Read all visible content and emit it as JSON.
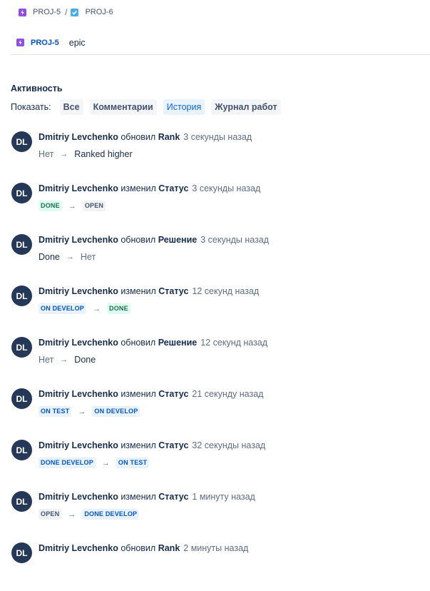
{
  "breadcrumbs": [
    {
      "key": "PROJ-5",
      "type": "epic"
    },
    {
      "key": "PROJ-6",
      "type": "task"
    }
  ],
  "breadcrumb_separator": "/",
  "child_issue": {
    "key": "PROJ-5",
    "summary": "epic",
    "type": "epic"
  },
  "activity": {
    "title": "Активность",
    "show_label": "Показать:",
    "filters": [
      {
        "label": "Все",
        "active": false
      },
      {
        "label": "Комментарии",
        "active": false
      },
      {
        "label": "История",
        "active": true
      },
      {
        "label": "Журнал работ",
        "active": false
      }
    ]
  },
  "arrow": "→",
  "colors": {
    "epic": "#904ee2",
    "task": "#4bade8",
    "link": "#0052cc",
    "avatar": "#253858"
  },
  "entries": [
    {
      "initials": "DL",
      "user": "Dmitriy Levchenko",
      "verb": "обновил",
      "field": "Rank",
      "time": "3 секунды назад",
      "from": {
        "text": "Нет",
        "kind": "null"
      },
      "to": {
        "text": "Ranked higher",
        "kind": "text"
      }
    },
    {
      "initials": "DL",
      "user": "Dmitriy Levchenko",
      "verb": "изменил",
      "field": "Статус",
      "time": "3 секунды назад",
      "from": {
        "text": "DONE",
        "kind": "green"
      },
      "to": {
        "text": "OPEN",
        "kind": "gray"
      }
    },
    {
      "initials": "DL",
      "user": "Dmitriy Levchenko",
      "verb": "обновил",
      "field": "Решение",
      "time": "3 секунды назад",
      "from": {
        "text": "Done",
        "kind": "text"
      },
      "to": {
        "text": "Нет",
        "kind": "null"
      }
    },
    {
      "initials": "DL",
      "user": "Dmitriy Levchenko",
      "verb": "изменил",
      "field": "Статус",
      "time": "12 секунд назад",
      "from": {
        "text": "ON DEVELOP",
        "kind": "blue"
      },
      "to": {
        "text": "DONE",
        "kind": "green"
      }
    },
    {
      "initials": "DL",
      "user": "Dmitriy Levchenko",
      "verb": "обновил",
      "field": "Решение",
      "time": "12 секунд назад",
      "from": {
        "text": "Нет",
        "kind": "null"
      },
      "to": {
        "text": "Done",
        "kind": "text"
      }
    },
    {
      "initials": "DL",
      "user": "Dmitriy Levchenko",
      "verb": "изменил",
      "field": "Статус",
      "time": "21 секунду назад",
      "from": {
        "text": "ON TEST",
        "kind": "blue"
      },
      "to": {
        "text": "ON DEVELOP",
        "kind": "blue"
      }
    },
    {
      "initials": "DL",
      "user": "Dmitriy Levchenko",
      "verb": "изменил",
      "field": "Статус",
      "time": "32 секунды назад",
      "from": {
        "text": "DONE DEVELOP",
        "kind": "blue"
      },
      "to": {
        "text": "ON TEST",
        "kind": "blue"
      }
    },
    {
      "initials": "DL",
      "user": "Dmitriy Levchenko",
      "verb": "изменил",
      "field": "Статус",
      "time": "1 минуту назад",
      "from": {
        "text": "OPEN",
        "kind": "gray"
      },
      "to": {
        "text": "DONE DEVELOP",
        "kind": "blue"
      }
    },
    {
      "initials": "DL",
      "user": "Dmitriy Levchenko",
      "verb": "обновил",
      "field": "Rank",
      "time": "2 минуты назад",
      "from": {
        "text": "",
        "kind": "text"
      },
      "to": {
        "text": "",
        "kind": "text"
      }
    }
  ]
}
